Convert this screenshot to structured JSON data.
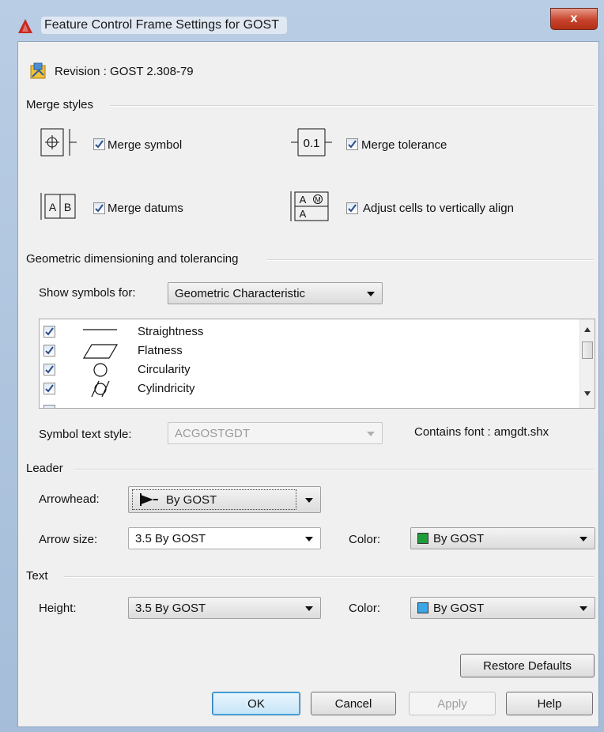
{
  "window": {
    "title": "Feature Control Frame Settings for GOST",
    "close_glyph": "x"
  },
  "revision": {
    "text": "Revision : GOST 2.308-79",
    "icon": "revision-icon"
  },
  "merge_styles": {
    "heading": "Merge styles",
    "merge_symbol": {
      "label": "Merge symbol",
      "checked": true
    },
    "merge_tolerance": {
      "label": "Merge tolerance",
      "checked": true,
      "icon_text": "0.1"
    },
    "merge_datums": {
      "label": "Merge datums",
      "checked": true,
      "icon_text_a": "A",
      "icon_text_b": "B"
    },
    "adjust_cells": {
      "label": "Adjust cells to vertically align",
      "checked": true,
      "icon_text_a": "A",
      "icon_text_m": "M"
    }
  },
  "gdt": {
    "heading": "Geometric dimensioning and tolerancing",
    "show_symbols_label": "Show symbols for:",
    "show_symbols_value": "Geometric Characteristic",
    "symbols": [
      {
        "name": "Straightness",
        "checked": true,
        "icon": "straightness-icon"
      },
      {
        "name": "Flatness",
        "checked": true,
        "icon": "flatness-icon"
      },
      {
        "name": "Circularity",
        "checked": true,
        "icon": "circularity-icon"
      },
      {
        "name": "Cylindricity",
        "checked": true,
        "icon": "cylindricity-icon"
      }
    ],
    "symbol_text_style_label": "Symbol text style:",
    "symbol_text_style_value": "ACGOSTGDT",
    "contains_font": "Contains font : amgdt.shx"
  },
  "leader": {
    "heading": "Leader",
    "arrowhead_label": "Arrowhead:",
    "arrowhead_value": "By GOST",
    "arrow_size_label": "Arrow size:",
    "arrow_size_value": "3.5  By GOST",
    "color_label": "Color:",
    "color_value": "By GOST",
    "color_swatch": "#1e9e3a"
  },
  "text": {
    "heading": "Text",
    "height_label": "Height:",
    "height_value": "3.5  By GOST",
    "color_label": "Color:",
    "color_value": "By GOST",
    "color_swatch": "#3aa8e6"
  },
  "buttons": {
    "restore_defaults": "Restore Defaults",
    "ok": "OK",
    "cancel": "Cancel",
    "apply": "Apply",
    "help": "Help"
  }
}
